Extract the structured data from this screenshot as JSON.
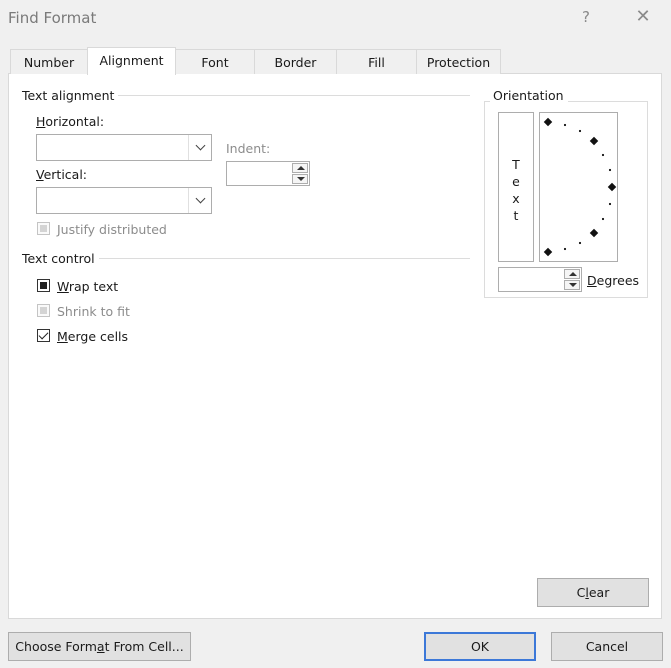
{
  "window": {
    "title": "Find Format",
    "help": "?",
    "close": "✕"
  },
  "tabs": [
    {
      "label": "Number"
    },
    {
      "label": "Alignment",
      "active": true
    },
    {
      "label": "Font"
    },
    {
      "label": "Border"
    },
    {
      "label": "Fill"
    },
    {
      "label": "Protection"
    }
  ],
  "text_alignment": {
    "section_title": "Text alignment",
    "horizontal": {
      "label_accel": "H",
      "label_rest": "orizontal:",
      "value": ""
    },
    "vertical": {
      "label_accel": "V",
      "label_rest": "ertical:",
      "value": ""
    },
    "indent": {
      "label": "Indent:",
      "value": ""
    },
    "justify_distributed": {
      "label": "Justify distributed",
      "state": "disabled-indeterminate"
    }
  },
  "text_control": {
    "section_title": "Text control",
    "wrap_text": {
      "label_accel": "W",
      "label_rest": "rap text",
      "state": "indeterminate"
    },
    "shrink_to_fit": {
      "label": "Shrink to fit",
      "state": "disabled-indeterminate"
    },
    "merge_cells": {
      "label_accel": "M",
      "label_rest": "erge cells",
      "state": "checked"
    }
  },
  "orientation": {
    "section_title": "Orientation",
    "vertical_text": [
      "T",
      "e",
      "x",
      "t"
    ],
    "degrees": {
      "value": "",
      "label_accel": "D",
      "label_rest": "egrees"
    }
  },
  "buttons": {
    "clear": {
      "pre": "C",
      "accel": "l",
      "post": "ear"
    },
    "choose_format": {
      "pre": "Choose Form",
      "accel": "a",
      "post": "t From Cell..."
    },
    "ok": "OK",
    "cancel": "Cancel"
  }
}
